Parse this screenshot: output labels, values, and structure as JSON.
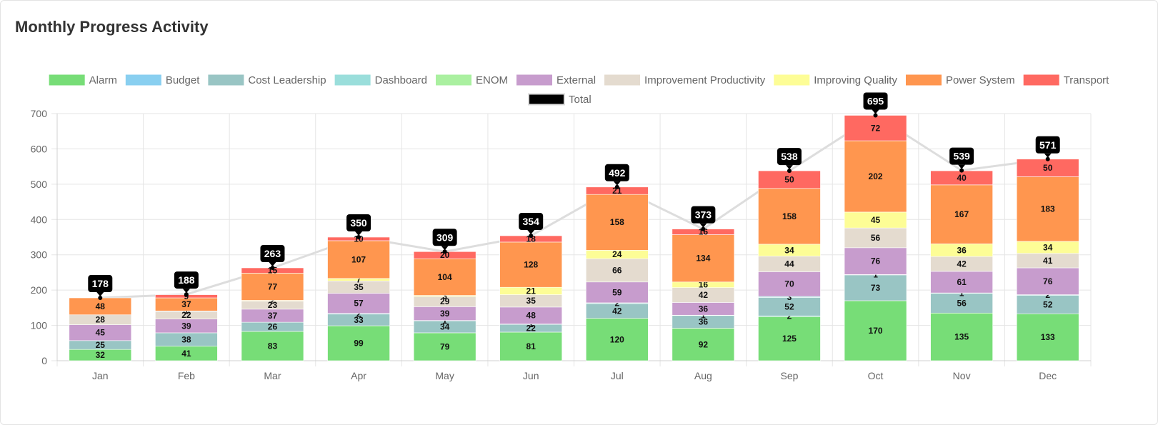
{
  "card": {
    "title": "Monthly Progress Activity"
  },
  "chart_data": {
    "type": "bar",
    "stacked": true,
    "title": "Monthly Progress Activity",
    "categories": [
      "Jan",
      "Feb",
      "Mar",
      "Apr",
      "May",
      "Jun",
      "Jul",
      "Aug",
      "Sep",
      "Oct",
      "Nov",
      "Dec"
    ],
    "ylim": [
      0,
      700
    ],
    "yticks": [
      0,
      100,
      200,
      300,
      400,
      500,
      600,
      700
    ],
    "grid": true,
    "legend_position": "top",
    "series": [
      {
        "name": "Alarm",
        "color": "#77dd77",
        "values": [
          32,
          41,
          83,
          99,
          79,
          81,
          120,
          92,
          125,
          170,
          135,
          133
        ]
      },
      {
        "name": "Budget",
        "color": "#89cff0",
        "values": [
          0,
          0,
          0,
          0,
          0,
          0,
          0,
          0,
          2,
          0,
          0,
          0
        ]
      },
      {
        "name": "Cost Leadership",
        "color": "#99c5c4",
        "values": [
          25,
          38,
          26,
          33,
          34,
          22,
          42,
          36,
          52,
          73,
          56,
          52
        ]
      },
      {
        "name": "Dashboard",
        "color": "#9adedb",
        "values": [
          0,
          0,
          0,
          2,
          1,
          1,
          2,
          1,
          3,
          1,
          1,
          2
        ]
      },
      {
        "name": "ENOM",
        "color": "#aaf0a0",
        "values": [
          0,
          0,
          0,
          0,
          0,
          0,
          0,
          0,
          0,
          0,
          0,
          0
        ]
      },
      {
        "name": "External",
        "color": "#c79ccd",
        "values": [
          45,
          39,
          37,
          57,
          39,
          48,
          59,
          36,
          70,
          76,
          61,
          76
        ]
      },
      {
        "name": "Improvement Productivity",
        "color": "#e4dbcf",
        "values": [
          28,
          22,
          23,
          35,
          29,
          35,
          66,
          42,
          44,
          56,
          42,
          41
        ]
      },
      {
        "name": "Improving Quality",
        "color": "#fdfd96",
        "values": [
          0,
          1,
          2,
          7,
          3,
          21,
          24,
          16,
          34,
          45,
          36,
          34
        ]
      },
      {
        "name": "Power System",
        "color": "#ff964f",
        "values": [
          48,
          37,
          77,
          107,
          104,
          128,
          158,
          134,
          158,
          202,
          167,
          183
        ]
      },
      {
        "name": "Transport",
        "color": "#ff6961",
        "values": [
          0,
          9,
          15,
          10,
          20,
          18,
          21,
          16,
          50,
          72,
          40,
          50
        ]
      }
    ],
    "total": {
      "name": "Total",
      "type": "line",
      "color": "#000000",
      "values": [
        178,
        188,
        263,
        350,
        309,
        354,
        492,
        373,
        538,
        695,
        539,
        571
      ]
    }
  }
}
